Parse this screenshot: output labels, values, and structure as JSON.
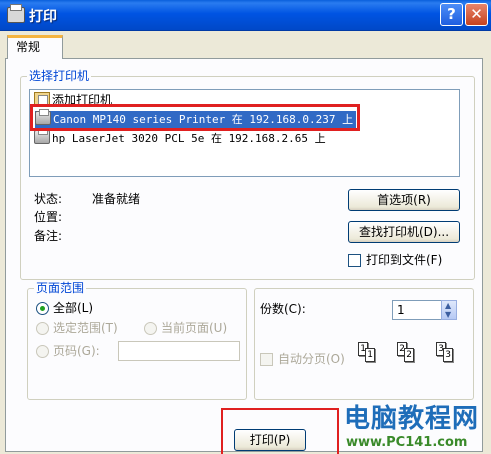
{
  "window": {
    "title": "打印",
    "help": "?",
    "close": "✕"
  },
  "tab": {
    "label": "常规"
  },
  "printer_group": {
    "legend": "选择打印机",
    "printers": [
      {
        "label": "添加打印机"
      },
      {
        "label": "Canon MP140 series Printer 在 192.168.0.237 上"
      },
      {
        "label": "hp LaserJet 3020 PCL 5e 在 192.168.2.65 上"
      }
    ],
    "status_label": "状态:",
    "status_value": "准备就绪",
    "location_label": "位置:",
    "comment_label": "备注:",
    "preferences_button": "首选项(R)",
    "find_printer_button": "查找打印机(D)...",
    "print_to_file_label": "打印到文件(F)"
  },
  "page_range": {
    "legend": "页面范围",
    "all_label": "全部(L)",
    "selection_label": "选定范围(T)",
    "current_page_label": "当前页面(U)",
    "pages_label": "页码(G):",
    "pages_value": ""
  },
  "copies": {
    "label": "份数(C):",
    "value": "1",
    "collate_label": "自动分页(O)",
    "page_nums": [
      "1",
      "1",
      "2",
      "2",
      "3",
      "3"
    ]
  },
  "footer": {
    "print_button": "打印(P)"
  },
  "watermark": {
    "title": "电脑教程网",
    "url": "www.PC141.com"
  }
}
